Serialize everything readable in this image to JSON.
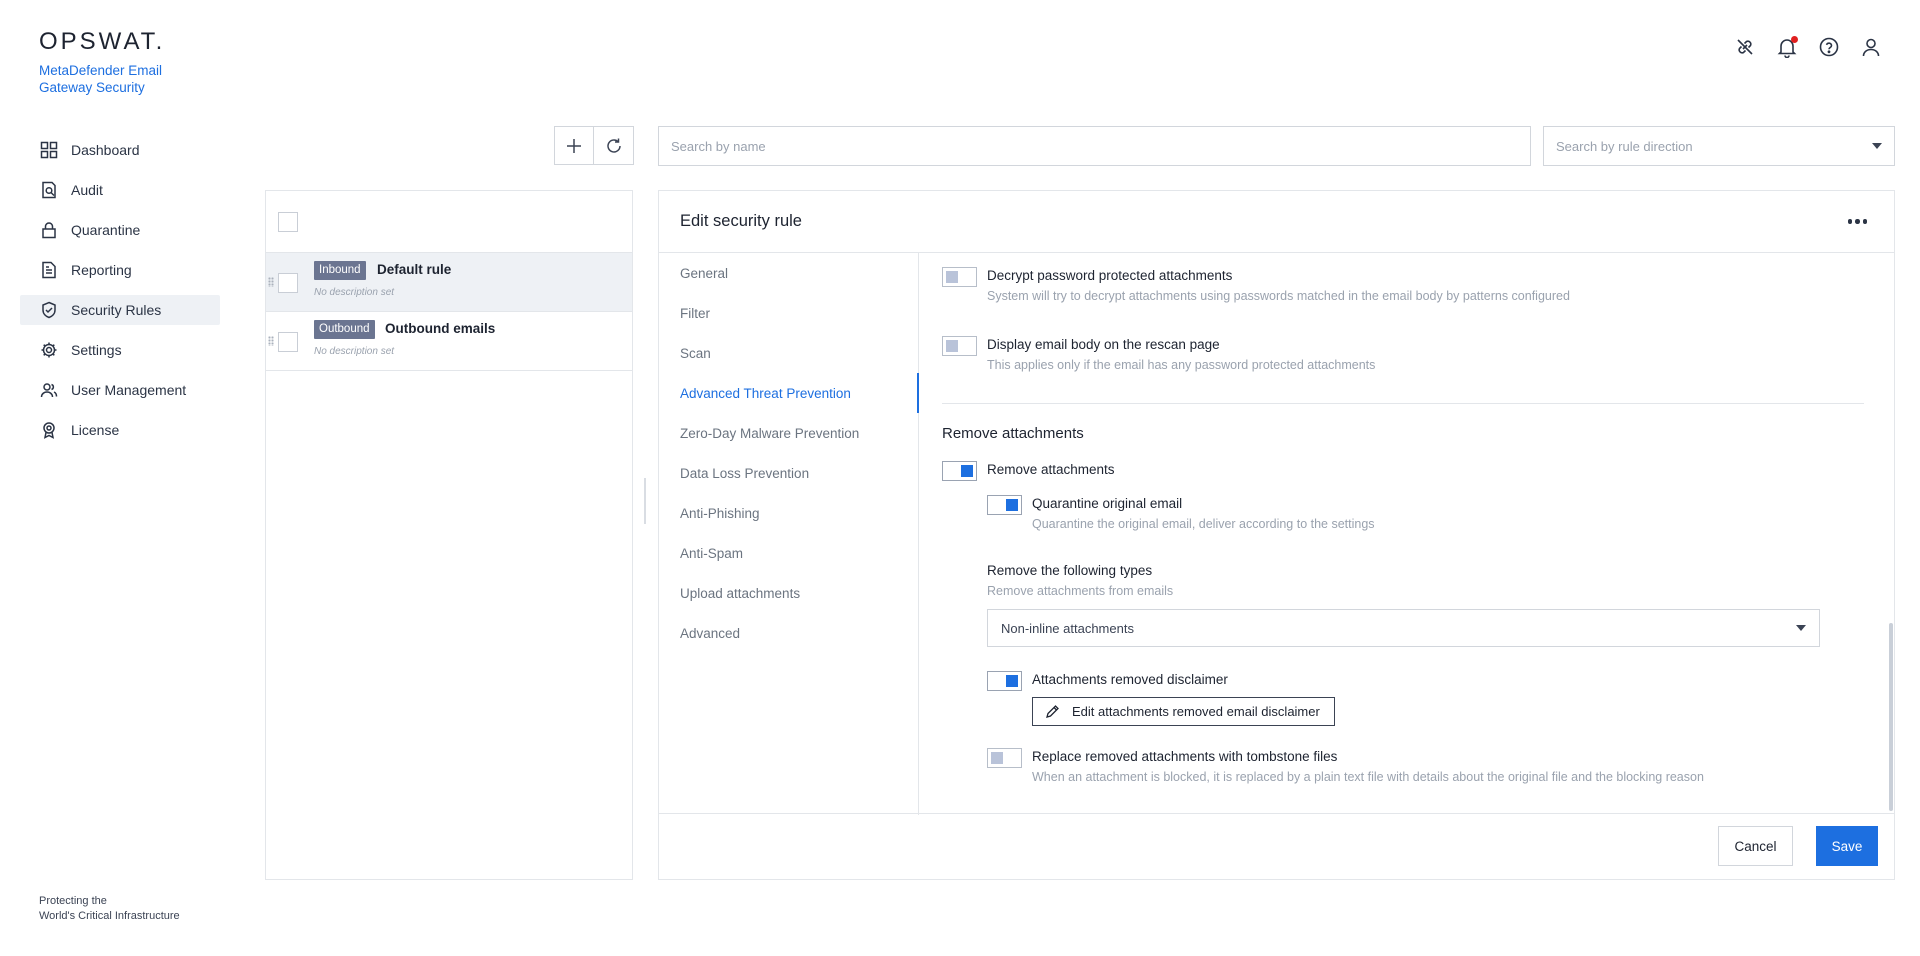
{
  "brand": {
    "logo_text": "OPSWAT.",
    "product_name": "MetaDefender Email Gateway Security",
    "tagline_line1": "Protecting the",
    "tagline_line2": "World's Critical Infrastructure"
  },
  "sidebar": {
    "items": [
      {
        "label": "Dashboard",
        "icon": "dashboard-icon"
      },
      {
        "label": "Audit",
        "icon": "audit-icon"
      },
      {
        "label": "Quarantine",
        "icon": "lock-icon"
      },
      {
        "label": "Reporting",
        "icon": "report-icon"
      },
      {
        "label": "Security Rules",
        "icon": "shield-check-icon",
        "active": true
      },
      {
        "label": "Settings",
        "icon": "gear-icon"
      },
      {
        "label": "User Management",
        "icon": "users-icon"
      },
      {
        "label": "License",
        "icon": "badge-icon"
      }
    ]
  },
  "header": {
    "icons": [
      "link-off-icon",
      "bell-icon",
      "help-icon",
      "user-icon"
    ],
    "notification_dot": true
  },
  "toolbar": {
    "search_name_placeholder": "Search by name",
    "search_direction_placeholder": "Search by rule direction"
  },
  "rules": [
    {
      "direction": "Inbound",
      "name": "Default rule",
      "description": "No description set",
      "selected": true
    },
    {
      "direction": "Outbound",
      "name": "Outbound emails",
      "description": "No description set",
      "selected": false
    }
  ],
  "edit_panel": {
    "title": "Edit security rule",
    "tabs": [
      {
        "label": "General"
      },
      {
        "label": "Filter"
      },
      {
        "label": "Scan"
      },
      {
        "label": "Advanced Threat Prevention",
        "active": true
      },
      {
        "label": "Zero-Day Malware Prevention"
      },
      {
        "label": "Data Loss Prevention"
      },
      {
        "label": "Anti-Phishing"
      },
      {
        "label": "Anti-Spam"
      },
      {
        "label": "Upload attachments"
      },
      {
        "label": "Advanced"
      }
    ],
    "options": {
      "decrypt": {
        "label": "Decrypt password protected attachments",
        "description": "System will try to decrypt attachments using passwords matched in the email body by patterns configured",
        "enabled": false
      },
      "display_body": {
        "label": "Display email body on the rescan page",
        "description": "This applies only if the email has any password protected attachments",
        "enabled": false
      },
      "section_title": "Remove attachments",
      "remove_attachments": {
        "label": "Remove attachments",
        "enabled": true
      },
      "quarantine_original": {
        "label": "Quarantine original email",
        "description": "Quarantine the original email, deliver according to the settings",
        "enabled": true
      },
      "remove_types": {
        "label": "Remove the following types",
        "description": "Remove attachments from emails",
        "selected": "Non-inline attachments"
      },
      "disclaimer": {
        "label": "Attachments removed disclaimer",
        "enabled": true,
        "edit_button": "Edit attachments removed email disclaimer"
      },
      "tombstone": {
        "label": "Replace removed attachments with tombstone files",
        "description": "When an attachment is blocked, it is replaced by a plain text file with details about the original file and the blocking reason",
        "enabled": false
      }
    },
    "footer": {
      "cancel_label": "Cancel",
      "save_label": "Save"
    }
  },
  "colors": {
    "accent": "#1d6fe0",
    "tag_bg": "#6b7591",
    "notification": "#e02020"
  }
}
